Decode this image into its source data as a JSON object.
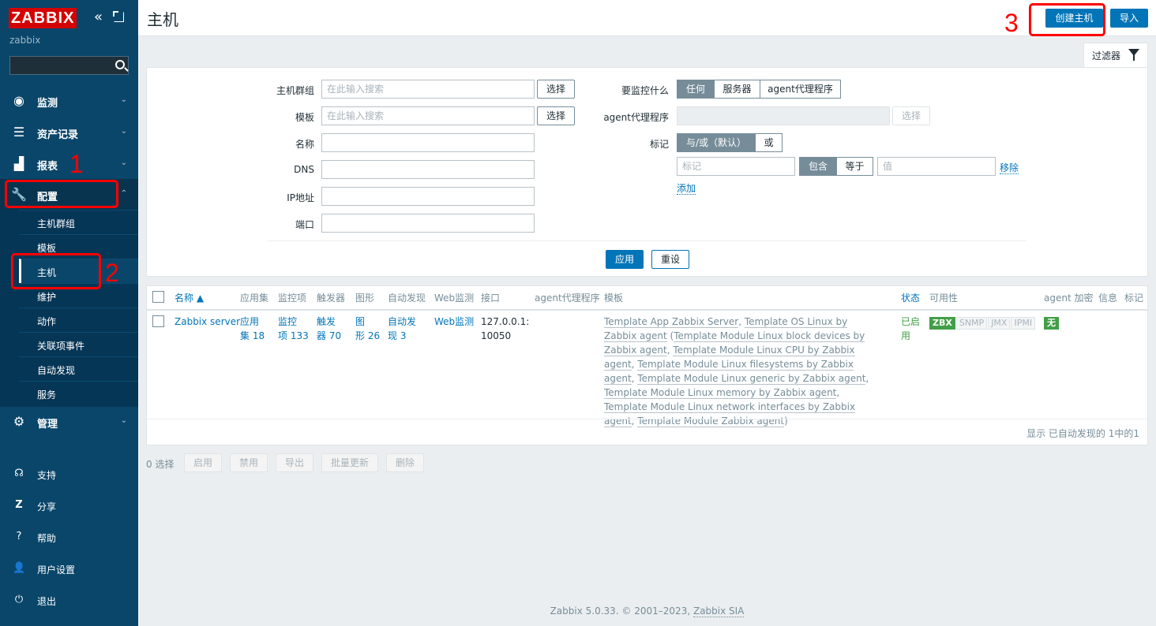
{
  "sidebar": {
    "logo": "ZABBIX",
    "server_name": "zabbix",
    "search_placeholder": "",
    "menu": [
      {
        "label": "监测",
        "icon": "eye-icon"
      },
      {
        "label": "资产记录",
        "icon": "list-icon"
      },
      {
        "label": "报表",
        "icon": "bar-chart-icon"
      },
      {
        "label": "配置",
        "icon": "wrench-icon"
      },
      {
        "label": "管理",
        "icon": "gear-icon"
      }
    ],
    "config_submenu": [
      "主机群组",
      "模板",
      "主机",
      "维护",
      "动作",
      "关联项事件",
      "自动发现",
      "服务"
    ],
    "bottom": [
      {
        "label": "支持",
        "icon": "headset-icon"
      },
      {
        "label": "分享",
        "icon": "share-icon"
      },
      {
        "label": "帮助",
        "icon": "help-icon"
      },
      {
        "label": "用户设置",
        "icon": "user-icon"
      },
      {
        "label": "退出",
        "icon": "power-icon"
      }
    ]
  },
  "annotations": {
    "one": "1",
    "two": "2",
    "three": "3"
  },
  "header": {
    "title": "主机",
    "create_button": "创建主机",
    "import_button": "导入"
  },
  "filter": {
    "tab_label": "过滤器",
    "host_group_label": "主机群组",
    "template_label": "模板",
    "name_label": "名称",
    "dns_label": "DNS",
    "ip_label": "IP地址",
    "port_label": "端口",
    "search_placeholder": "在此输入搜索",
    "select_button": "选择",
    "monitored_by_label": "要监控什么",
    "monitored_by_options": [
      "任何",
      "服务器",
      "agent代理程序"
    ],
    "proxy_label": "agent代理程序",
    "tags_label": "标记",
    "tags_eval_options": [
      "与/或（默认）",
      "或"
    ],
    "tag_placeholder": "标记",
    "tag_operator_options": [
      "包含",
      "等于"
    ],
    "value_placeholder": "值",
    "remove_link": "移除",
    "add_link": "添加",
    "apply_button": "应用",
    "reset_button": "重设"
  },
  "table": {
    "headers": {
      "name": "名称 ▲",
      "applications": "应用集",
      "items": "监控项",
      "triggers": "触发器",
      "graphs": "图形",
      "discovery": "自动发现",
      "web": "Web监测",
      "interface": "接口",
      "proxy": "agent代理程序",
      "templates": "模板",
      "status": "状态",
      "availability": "可用性",
      "encryption": "agent 加密",
      "info": "信息",
      "tags": "标记"
    },
    "row": {
      "name": "Zabbix server",
      "applications_line1": "应用",
      "applications_line2": "集 18",
      "items_line1": "监控",
      "items_line2": "项 133",
      "triggers_line1": "触发",
      "triggers_line2": "器 70",
      "graphs_line1": "图",
      "graphs_line2": "形 26",
      "discovery_line1": "自动发",
      "discovery_line2": "现 3",
      "web": "Web监测",
      "interface_line1": "127.0.0.1:",
      "interface_line2": "10050",
      "templates": [
        "Template App Zabbix Server",
        "Template OS Linux by Zabbix agent",
        "Template Module Linux block devices by Zabbix agent",
        "Template Module Linux CPU by Zabbix agent",
        "Template Module Linux filesystems by Zabbix agent",
        "Template Module Linux generic by Zabbix agent",
        "Template Module Linux memory by Zabbix agent",
        "Template Module Linux network interfaces by Zabbix agent",
        "Template Module Zabbix agent"
      ],
      "status_line1": "已启",
      "status_line2": "用",
      "availability": [
        "ZBX",
        "SNMP",
        "JMX",
        "IPMI"
      ],
      "encryption": "无"
    },
    "footer": "显示 已自动发现的 1中的1"
  },
  "actions": {
    "selected": "0 选择",
    "buttons": [
      "启用",
      "禁用",
      "导出",
      "批量更新",
      "删除"
    ]
  },
  "footer": {
    "text": "Zabbix 5.0.33. © 2001–2023,",
    "link": "Zabbix SIA"
  },
  "colors": {
    "sidebar": "#0a466a",
    "primary": "#0275b8",
    "annotation": "#ff0000",
    "enabled": "#429e47"
  }
}
